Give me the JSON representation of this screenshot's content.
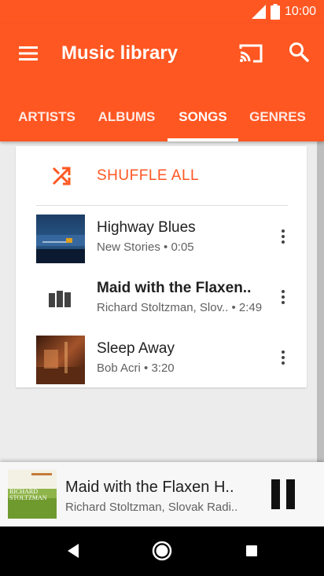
{
  "status_bar": {
    "time": "10:00",
    "icons": [
      "signal-icon",
      "battery-icon"
    ]
  },
  "app_bar": {
    "title": "Music library",
    "icons": [
      "menu-icon",
      "cast-icon",
      "search-icon"
    ],
    "background_color": "#ff5722"
  },
  "tabs": [
    {
      "label": "ARTISTS",
      "active": false
    },
    {
      "label": "ALBUMS",
      "active": false
    },
    {
      "label": "SONGS",
      "active": true
    },
    {
      "label": "GENRES",
      "active": false
    }
  ],
  "shuffle": {
    "label": "SHUFFLE ALL",
    "icon": "shuffle-icon",
    "color": "#ff5722"
  },
  "songs": [
    {
      "title": "Highway Blues",
      "subtitle": "New Stories • 0:05",
      "art": "album-cover",
      "playing": false
    },
    {
      "title": "Maid with the Flaxen..",
      "subtitle": "Richard Stoltzman, Slov.. • 2:49",
      "art": "equalizer-icon",
      "playing": true
    },
    {
      "title": "Sleep Away",
      "subtitle": "Bob Acri • 3:20",
      "art": "album-cover",
      "playing": false
    }
  ],
  "now_playing": {
    "title": "Maid with the Flaxen H..",
    "subtitle": "Richard Stoltzman, Slovak Radi..",
    "art_text_line1": "RICHARD",
    "art_text_line2": "STOLTZMAN",
    "control_icon": "pause-icon"
  },
  "nav_bar": {
    "icons": [
      "back-icon",
      "home-icon",
      "recents-icon"
    ]
  }
}
